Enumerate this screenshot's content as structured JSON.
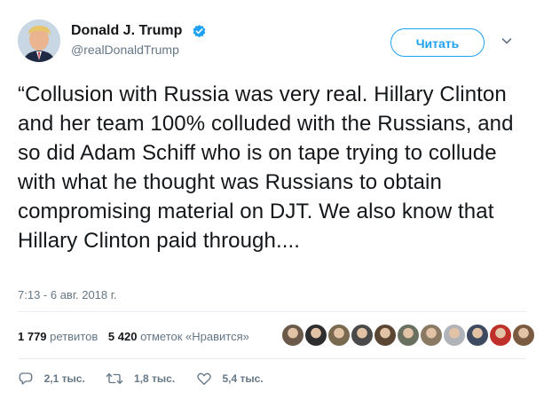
{
  "author": {
    "display_name": "Donald J. Trump",
    "handle": "@realDonaldTrump",
    "verified_icon": "verified-badge-icon",
    "avatar_icon": "profile-avatar"
  },
  "follow_button": {
    "label": "Читать"
  },
  "menu_icon": "chevron-down-icon",
  "tweet": {
    "text": "“Collusion with Russia was very real. Hillary Clinton and her team 100% colluded with the Russians, and so did Adam Schiff who is on tape trying to collude with what he thought was Russians to obtain compromising material on DJT. We also know that Hillary Clinton paid through....",
    "timestamp": "7:13 - 6 авг. 2018 г."
  },
  "stats": {
    "retweets_count": "1 779",
    "retweets_label": "ретвитов",
    "likes_count": "5 420",
    "likes_label": "отметок «Нравится»"
  },
  "liker_avatars": [
    "#6b5a4a",
    "#2e2e2e",
    "#7a6a50",
    "#4a4a4a",
    "#5b4634",
    "#6a7060",
    "#8a7a64",
    "#b0b4b8",
    "#3d4a60",
    "#c0302a",
    "#7a5a40"
  ],
  "actions": {
    "reply_count": "2,1 тыс.",
    "retweet_count": "1,8 тыс.",
    "like_count": "5,4 тыс."
  },
  "colors": {
    "accent": "#1da1f2",
    "text": "#14171a",
    "muted": "#657786",
    "divider": "#e6ecf0"
  }
}
